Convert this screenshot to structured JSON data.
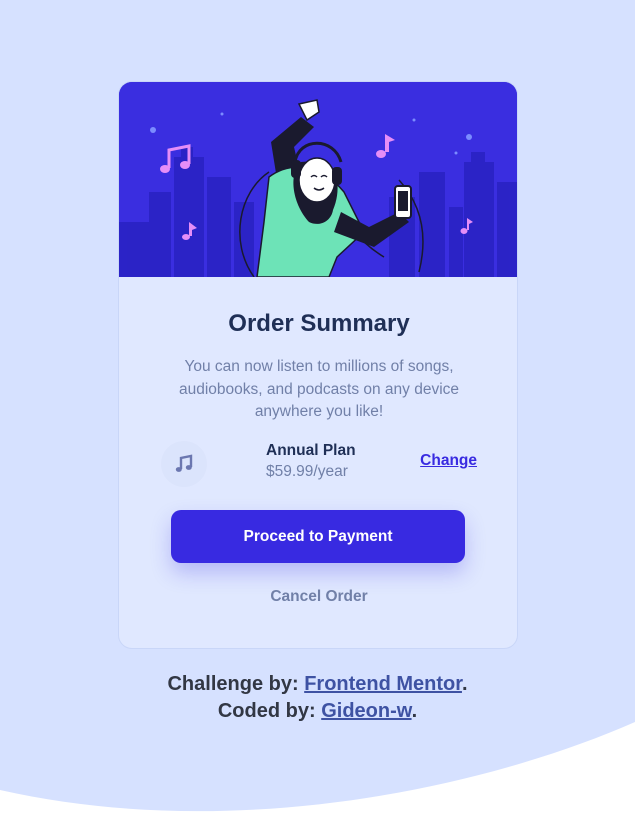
{
  "colors": {
    "background": "#d6e1ff",
    "card": "#e0e8ff",
    "accent": "#382ae1",
    "title": "#1f2f56",
    "muted": "#7180a8",
    "hero": "#3a2ee0",
    "link": "#3e52a3"
  },
  "card": {
    "title": "Order Summary",
    "description": "You can now listen to millions of songs, audiobooks, and podcasts on any device anywhere you like!",
    "plan": {
      "icon": "music-note-icon",
      "name": "Annual Plan",
      "price": "$59.99/year",
      "change_label": "Change"
    },
    "primary_button": "Proceed to Payment",
    "cancel_button": "Cancel Order"
  },
  "attribution": {
    "challenge_prefix": "Challenge by: ",
    "challenge_link": "Frontend Mentor",
    "coded_prefix": "Coded by: ",
    "coded_link": "Gideon-w",
    "period": "."
  }
}
